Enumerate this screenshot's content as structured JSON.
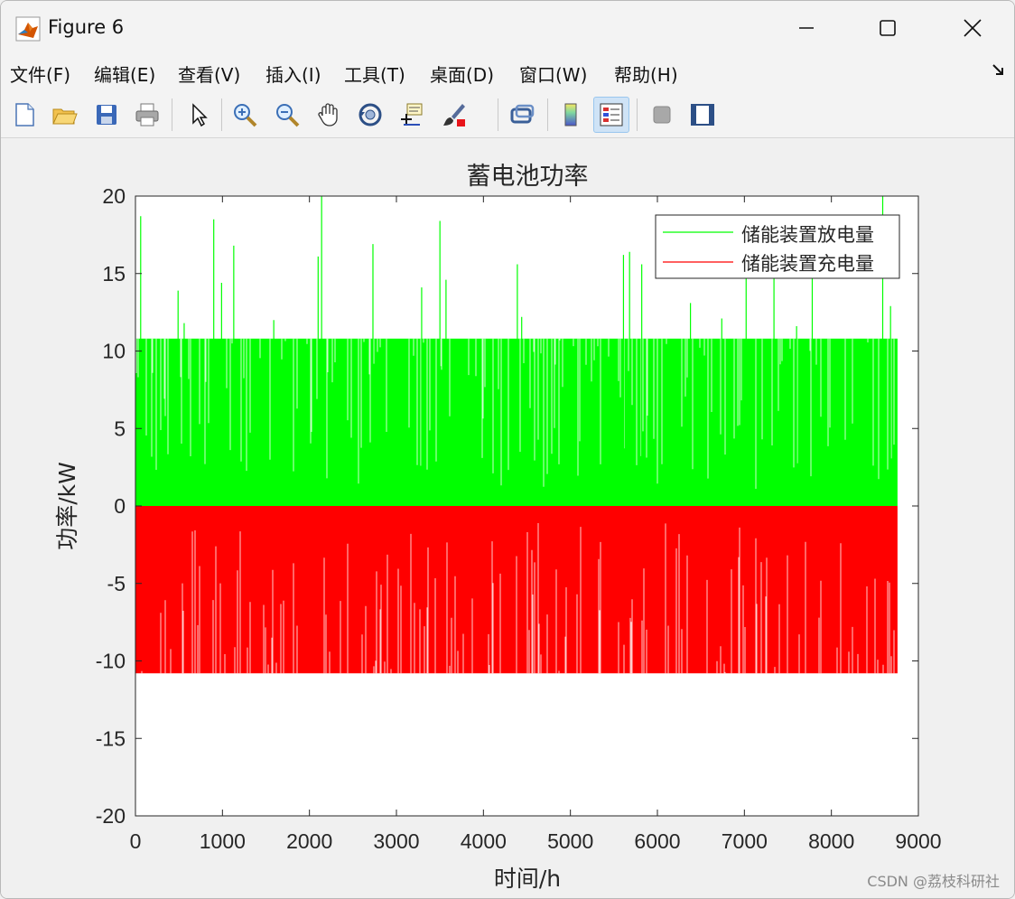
{
  "window": {
    "title": "Figure 6",
    "minimize_icon": "minimize-icon",
    "maximize_icon": "maximize-icon",
    "close_icon": "close-icon"
  },
  "menu": {
    "items": [
      "文件(F)",
      "编辑(E)",
      "查看(V)",
      "插入(I)",
      "工具(T)",
      "桌面(D)",
      "窗口(W)",
      "帮助(H)"
    ],
    "overflow_icon": "dock-arrow-icon"
  },
  "toolbar": {
    "buttons": [
      "new-figure-icon",
      "open-file-icon",
      "save-icon",
      "print-icon",
      "pointer-icon",
      "zoom-in-icon",
      "zoom-out-icon",
      "pan-hand-icon",
      "rotate-3d-icon",
      "data-cursor-icon",
      "brush-icon",
      "link-plot-icon",
      "colorbar-icon",
      "legend-icon",
      "hide-plot-tools-icon",
      "show-plot-tools-icon"
    ],
    "active": "legend-icon"
  },
  "chart_data": {
    "type": "bar",
    "title": "蓄电池功率",
    "xlabel": "时间/h",
    "ylabel": "功率/kW",
    "xlim": [
      0,
      9000
    ],
    "ylim": [
      -20,
      20
    ],
    "xticks": [
      0,
      1000,
      2000,
      3000,
      4000,
      5000,
      6000,
      7000,
      8000,
      9000
    ],
    "yticks": [
      20,
      15,
      10,
      5,
      0,
      -5,
      -10,
      -15,
      -20
    ],
    "x_extent": [
      0,
      8760
    ],
    "legend": {
      "position": "top-right",
      "entries": [
        "储能装置放电量",
        "储能装置充电量"
      ]
    },
    "series": [
      {
        "name": "储能装置放电量",
        "color": "#00ff00",
        "typical_max": 10.8,
        "peaks": [
          [
            60,
            18.7
          ],
          [
            490,
            13.9
          ],
          [
            560,
            11.8
          ],
          [
            900,
            18.5
          ],
          [
            990,
            14.4
          ],
          [
            1130,
            16.8
          ],
          [
            1590,
            12.0
          ],
          [
            2100,
            16.1
          ],
          [
            2140,
            20.0
          ],
          [
            2730,
            16.9
          ],
          [
            3290,
            14.1
          ],
          [
            3500,
            18.4
          ],
          [
            3570,
            14.6
          ],
          [
            4390,
            15.6
          ],
          [
            4440,
            12.2
          ],
          [
            5610,
            16.2
          ],
          [
            5680,
            16.4
          ],
          [
            5820,
            15.6
          ],
          [
            6380,
            13.1
          ],
          [
            6740,
            12.1
          ],
          [
            7020,
            15.0
          ],
          [
            7340,
            15.0
          ],
          [
            7600,
            11.6
          ],
          [
            7780,
            14.9
          ],
          [
            8590,
            20.0
          ],
          [
            8680,
            12.9
          ]
        ]
      },
      {
        "name": "储能装置充电量",
        "color": "#ff0000",
        "typical_min": -10.8
      }
    ]
  },
  "watermark": "CSDN @荔枝科研社"
}
